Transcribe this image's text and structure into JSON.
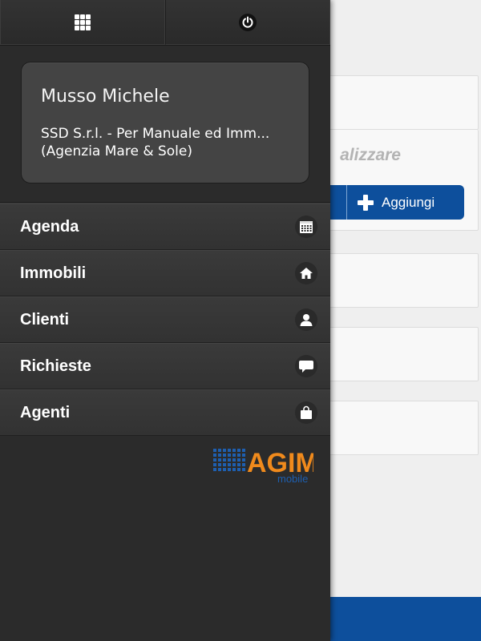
{
  "background": {
    "hint_text": "alizzare",
    "add_button_label": "Aggiungi"
  },
  "drawer": {
    "topbar": {
      "apps_icon": "grid-icon",
      "power_icon": "power-icon"
    },
    "profile": {
      "name": "Musso Michele",
      "company": "SSD S.r.l. - Per Manuale ed Imm...",
      "agency": "(Agenzia Mare & Sole)"
    },
    "menu": [
      {
        "label": "Agenda",
        "icon": "calendar-icon"
      },
      {
        "label": "Immobili",
        "icon": "home-icon"
      },
      {
        "label": "Clienti",
        "icon": "user-icon"
      },
      {
        "label": "Richieste",
        "icon": "chat-bubble-icon"
      },
      {
        "label": "Agenti",
        "icon": "shopping-bag-icon"
      }
    ],
    "logo": {
      "main_text": "AGIM",
      "sub_text": "mobile"
    }
  },
  "colors": {
    "drawer_bg": "#2b2b2b",
    "menu_item_bg": "#373737",
    "profile_card_bg": "#444444",
    "accent_blue": "#0d4f9c",
    "logo_orange": "#f08a1c",
    "logo_blue": "#1e5fb0"
  }
}
